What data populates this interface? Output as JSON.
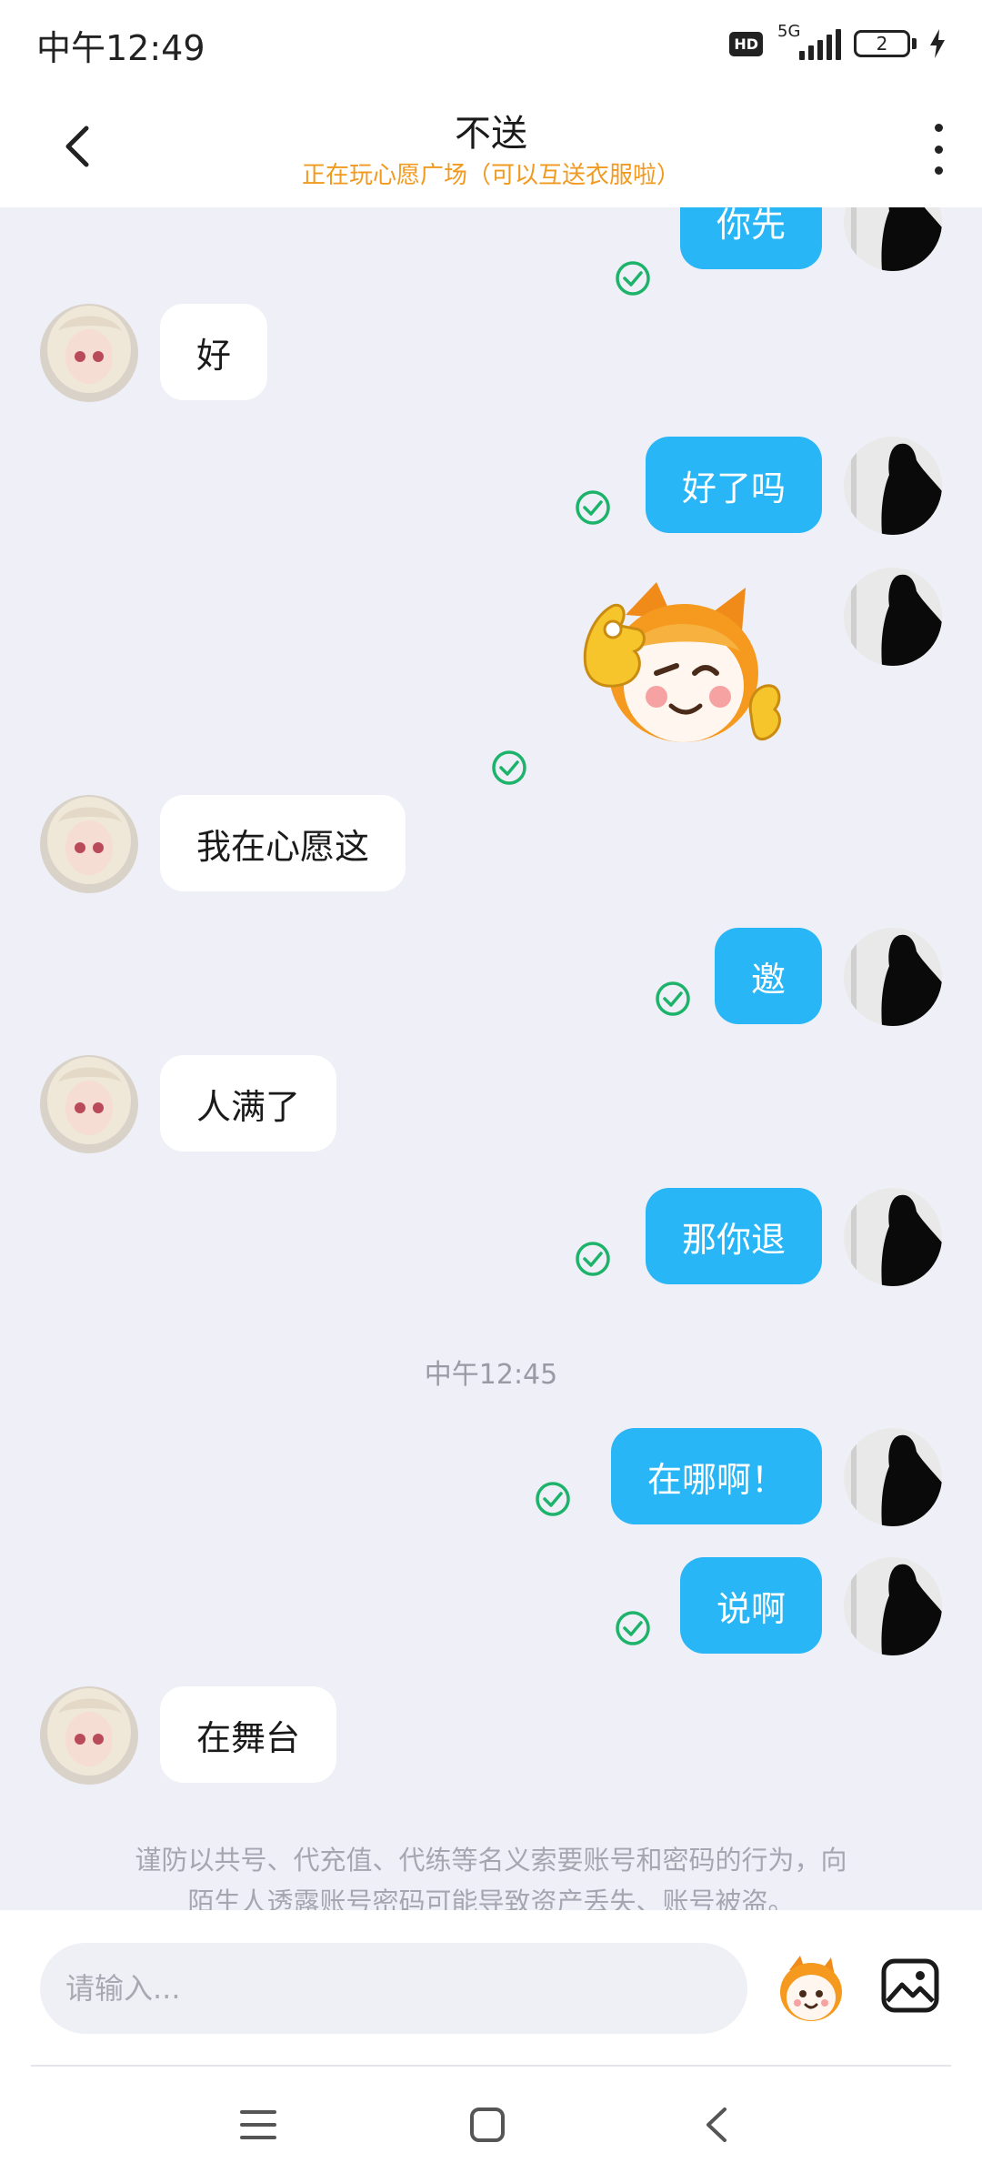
{
  "status_bar": {
    "time": "中午12:49",
    "hd_label": "HD",
    "network_label": "5G",
    "battery_level": "2",
    "icons": [
      "hd-icon",
      "signal-icon",
      "battery-icon",
      "charging-icon"
    ]
  },
  "header": {
    "title": "不送",
    "subtitle": "正在玩心愿广场（可以互送衣服啦）",
    "back_icon": "chevron-left-icon",
    "more_icon": "more-vertical-icon"
  },
  "messages": [
    {
      "side": "out",
      "text": "你先",
      "read": true
    },
    {
      "side": "in",
      "text": "好"
    },
    {
      "side": "out",
      "text": "好了吗",
      "read": true
    },
    {
      "side": "out",
      "type": "sticker",
      "sticker": "mascot-wink-sticker",
      "read": true
    },
    {
      "side": "in",
      "text": "我在心愿这"
    },
    {
      "side": "out",
      "text": "邀",
      "read": true
    },
    {
      "side": "in",
      "text": "人满了"
    },
    {
      "side": "out",
      "text": "那你退",
      "read": true
    },
    {
      "side": "out",
      "text": "在哪啊！",
      "read": true
    },
    {
      "side": "out",
      "text": "说啊",
      "read": true
    },
    {
      "side": "in",
      "text": "在舞台"
    }
  ],
  "time_divider": "中午12:45",
  "notice": {
    "line1": "谨防以共号、代充值、代练等名义索要账号和密码的行为，向",
    "line2": "陌生人透露账号密码可能导致资产丢失、账号被盗。"
  },
  "input": {
    "placeholder": "请输入..."
  },
  "colors": {
    "outgoing_bubble": "#29b6f6",
    "incoming_bubble": "#ffffff",
    "background": "#eff0f7",
    "subtitle": "#f09a20",
    "read_check": "#1db36b"
  }
}
